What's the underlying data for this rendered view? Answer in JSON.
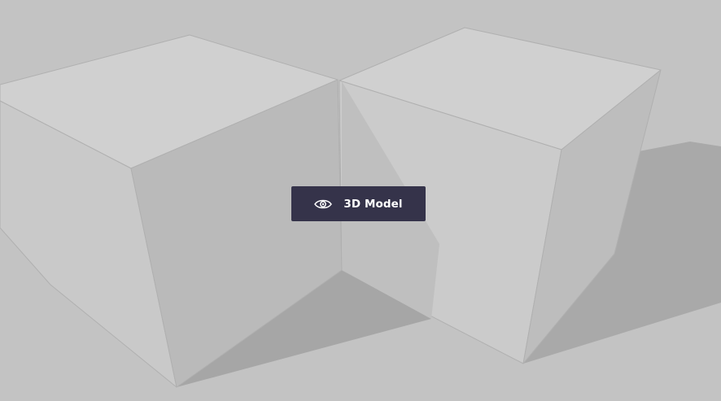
{
  "viewer": {
    "button_label": "3D Model",
    "button_icon": "eye-icon",
    "background_color": "#c3c3c3",
    "button_color": "#35334a"
  }
}
